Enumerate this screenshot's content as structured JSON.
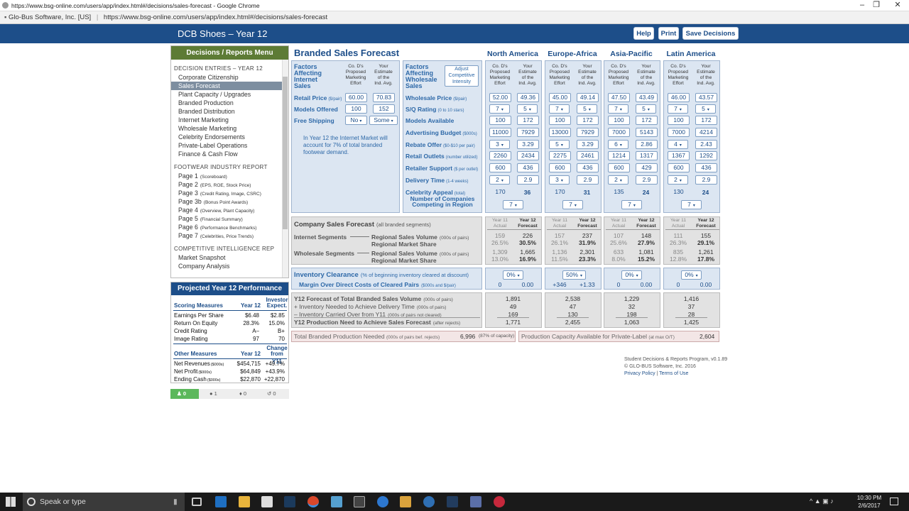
{
  "browser": {
    "window_title": "https://www.bsg-online.com/users/app/index.html#/decisions/sales-forecast - Google Chrome",
    "site_badge": "Glo-Bus Software, Inc. [US]",
    "url": "https://www.bsg-online.com/users/app/index.html#/decisions/sales-forecast"
  },
  "header": {
    "title": "DCB Shoes – Year 12",
    "help": "Help",
    "print": "Print",
    "save": "Save Decisions"
  },
  "sidebar": {
    "title": "Decisions / Reports Menu",
    "decision_section": "DECISION  ENTRIES – YEAR 12",
    "decision_items": [
      "Corporate Citizenship",
      "Sales Forecast",
      "Plant Capacity / Upgrades",
      "Branded Production",
      "Branded Distribution",
      "Internet Marketing",
      "Wholesale Marketing",
      "Celebrity Endorsements",
      "Private-Label Operations",
      "Finance & Cash Flow"
    ],
    "report_section": "FOOTWEAR  INDUSTRY REPORT",
    "report_items": [
      {
        "page": "Page 1",
        "desc": "(Scoreboard)"
      },
      {
        "page": "Page 2",
        "desc": "(EPS, ROE, Stock Price)"
      },
      {
        "page": "Page 3",
        "desc": "(Credit Rating, Image, CSRC)"
      },
      {
        "page": "Page 3b",
        "desc": "(Bonus Point Awards)"
      },
      {
        "page": "Page 4",
        "desc": "(Overview, Plant Capacity)"
      },
      {
        "page": "Page 5",
        "desc": "(Financial Summary)"
      },
      {
        "page": "Page 6",
        "desc": "(Performance Benchmarks)"
      },
      {
        "page": "Page 7",
        "desc": "(Celebrities, Price Trends)"
      }
    ],
    "intel_section": "COMPETITIVE  INTELLIGENCE REP",
    "intel_items": [
      "Market Snapshot",
      "Company Analysis"
    ]
  },
  "performance": {
    "title": "Projected Year 12 Performance",
    "scoring_header": "Scoring Measures",
    "col_year": "Year 12",
    "col_expect_1": "Investor",
    "col_expect_2": "Expect.",
    "scoring_rows": [
      {
        "label": "Earnings Per Share",
        "y12": "$6.48",
        "exp": "$2.85"
      },
      {
        "label": "Return On Equity",
        "y12": "28.3%",
        "exp": "15.0%"
      },
      {
        "label": "Credit Rating",
        "y12": "A–",
        "exp": "B+"
      },
      {
        "label": "Image Rating",
        "y12": "97",
        "exp": "70"
      }
    ],
    "other_header": "Other Measures",
    "col_change_1": "Change",
    "col_change_2": "from Y11",
    "other_rows": [
      {
        "label": "Net Revenues",
        "unit": "($000s)",
        "y12": "$454,715",
        "chg": "+49.7%"
      },
      {
        "label": "Net Profit",
        "unit": "($000s)",
        "y12": "$64,849",
        "chg": "+43.9%"
      },
      {
        "label": "Ending Cash",
        "unit": "($000s)",
        "y12": "$22,870",
        "chg": "+22,870"
      }
    ]
  },
  "social": {
    "group": "0",
    "comments": "1",
    "mic": "0",
    "share": "0"
  },
  "main": {
    "title": "Branded Sales Forecast",
    "regions": [
      "North America",
      "Europe-Africa",
      "Asia-Pacific",
      "Latin America"
    ],
    "internet": {
      "title": [
        "Factors",
        "Affecting",
        "Internet",
        "Sales"
      ],
      "col1": [
        "Co. D's",
        "Proposed",
        "Marketing",
        "Effort"
      ],
      "col2": [
        "Your",
        "Estimate",
        "of the",
        "Ind. Avg."
      ],
      "rows": [
        {
          "label": "Retail Price",
          "unit": "($/pair)",
          "own": "60.00",
          "avg": "70.83"
        },
        {
          "label": "Models Offered",
          "unit": "",
          "own": "100",
          "avg": "152"
        },
        {
          "label": "Free Shipping",
          "unit": "",
          "own": "No",
          "avg": "Some"
        }
      ],
      "note": "In Year 12 the Internet Market will account for 7% of total branded footwear demand."
    },
    "wholesale": {
      "title": [
        "Factors",
        "Affecting",
        "Wholesale",
        "Sales"
      ],
      "adjust": [
        "Adjust",
        "Competitive",
        "Intensity"
      ],
      "labels": [
        {
          "label": "Wholesale Price",
          "unit": "($/pair)"
        },
        {
          "label": "S/Q Rating",
          "unit": "(0 to 10 stars)"
        },
        {
          "label": "Models Available",
          "unit": ""
        },
        {
          "label": "Advertising Budget",
          "unit": "($000s)"
        },
        {
          "label": "Rebate Offer",
          "unit": "($0-$10 per pair)"
        },
        {
          "label": "Retail Outlets",
          "unit": "(number utilized)"
        },
        {
          "label": "Retailer Support",
          "unit": "($ per outlet)"
        },
        {
          "label": "Delivery Time",
          "unit": "(1-4 weeks)"
        },
        {
          "label": "Celebrity Appeal",
          "unit": "(total)"
        }
      ],
      "competing_label": [
        "Number of Companies",
        "Competing in Region"
      ],
      "region_cols": {
        "c1": [
          "Co. D's",
          "Proposed",
          "Marketing",
          "Effort"
        ],
        "c2": [
          "Your",
          "Estimate",
          "of the",
          "Ind. Avg."
        ]
      },
      "values": [
        {
          "own": [
            "52.00",
            "7",
            "100",
            "11000",
            "3",
            "2260",
            "600",
            "2",
            "170"
          ],
          "avg": [
            "49.36",
            "5",
            "172",
            "7929",
            "3.29",
            "2434",
            "436",
            "2.9",
            "36"
          ],
          "competing": "7"
        },
        {
          "own": [
            "45.00",
            "7",
            "100",
            "13000",
            "5",
            "2275",
            "600",
            "3",
            "170"
          ],
          "avg": [
            "49.14",
            "5",
            "172",
            "7929",
            "3.29",
            "2461",
            "436",
            "2.9",
            "31"
          ],
          "competing": "7"
        },
        {
          "own": [
            "47.50",
            "7",
            "100",
            "7000",
            "6",
            "1214",
            "600",
            "2",
            "135"
          ],
          "avg": [
            "43.49",
            "5",
            "172",
            "5143",
            "2.86",
            "1317",
            "429",
            "2.9",
            "24"
          ],
          "competing": "7"
        },
        {
          "own": [
            "46.00",
            "7",
            "100",
            "7000",
            "4",
            "1367",
            "600",
            "2",
            "130"
          ],
          "avg": [
            "43.57",
            "5",
            "172",
            "4214",
            "2.43",
            "1292",
            "436",
            "2.9",
            "24"
          ],
          "competing": "7"
        }
      ]
    },
    "company_forecast": {
      "title": "Company Sales Forecast",
      "subtitle": "(all branded segments)",
      "internet_seg": "Internet Segments",
      "wholesale_seg": "Wholesale Segments",
      "vol_label": "Regional Sales Volume",
      "vol_unit": "(000s of pairs)",
      "share_label": "Regional Market Share",
      "col_a": [
        "Year 11",
        "Actual"
      ],
      "col_b": [
        "Year 12",
        "Forecast"
      ],
      "regions": [
        {
          "i_vol": [
            "159",
            "226"
          ],
          "i_share": [
            "26.5%",
            "30.5%"
          ],
          "w_vol": [
            "1,309",
            "1,665"
          ],
          "w_share": [
            "13.0%",
            "16.9%"
          ]
        },
        {
          "i_vol": [
            "157",
            "237"
          ],
          "i_share": [
            "26.1%",
            "31.9%"
          ],
          "w_vol": [
            "1,136",
            "2,301"
          ],
          "w_share": [
            "11.5%",
            "23.3%"
          ]
        },
        {
          "i_vol": [
            "107",
            "148"
          ],
          "i_share": [
            "25.6%",
            "27.9%"
          ],
          "w_vol": [
            "633",
            "1,081"
          ],
          "w_share": [
            "8.0%",
            "15.2%"
          ]
        },
        {
          "i_vol": [
            "111",
            "155"
          ],
          "i_share": [
            "26.3%",
            "29.1%"
          ],
          "w_vol": [
            "835",
            "1,261"
          ],
          "w_share": [
            "12.8%",
            "17.8%"
          ]
        }
      ]
    },
    "clearance": {
      "label": "Inventory Clearance",
      "unit": "(% of beginning inventory cleared at discount)",
      "margin_label": "Margin Over Direct Costs of Cleared Pairs",
      "margin_unit": "($000s and $/pair)",
      "regions": [
        {
          "pct": "0%",
          "a": "0",
          "b": "0.00"
        },
        {
          "pct": "50%",
          "a": "+346",
          "b": "+1.33"
        },
        {
          "pct": "0%",
          "a": "0",
          "b": "0.00"
        },
        {
          "pct": "0%",
          "a": "0",
          "b": "0.00"
        }
      ]
    },
    "production": {
      "lines": [
        {
          "label": "Y12 Forecast of Total Branded Sales Volume",
          "unit": "(000s of pairs)"
        },
        {
          "label": "+ Inventory Needed to Achieve Delivery Time",
          "unit": "(000s of pairs)"
        },
        {
          "label": "– Inventory Carried Over from Y11",
          "unit": "(000s of pairs not cleared)"
        },
        {
          "label": "Y12 Production Need to Achieve Sales Forecast",
          "unit": "(after rejects)"
        }
      ],
      "regions": [
        [
          "1,891",
          "49",
          "169",
          "1,771"
        ],
        [
          "2,538",
          "47",
          "130",
          "2,455"
        ],
        [
          "1,229",
          "32",
          "198",
          "1,063"
        ],
        [
          "1,416",
          "37",
          "28",
          "1,425"
        ]
      ]
    },
    "total_needed": {
      "label": "Total Branded Production Needed",
      "unit": "(000s of pairs bef. rejects)",
      "value": "6,996",
      "pct": "(87% of capacity)"
    },
    "capacity": {
      "label": "Production Capacity Available for Private-Label",
      "unit": "(at max O/T)",
      "value": "2,604"
    },
    "footer": {
      "line1": "Student Decisions & Reports Program, v0.1.89",
      "line2": "© GLO-BUS Software, Inc. 2016",
      "privacy": "Privacy Policy",
      "sep": " | ",
      "terms": "Terms of Use"
    }
  },
  "taskbar": {
    "search": "Speak or type",
    "time": "10:30 PM",
    "date": "2/6/2017"
  }
}
